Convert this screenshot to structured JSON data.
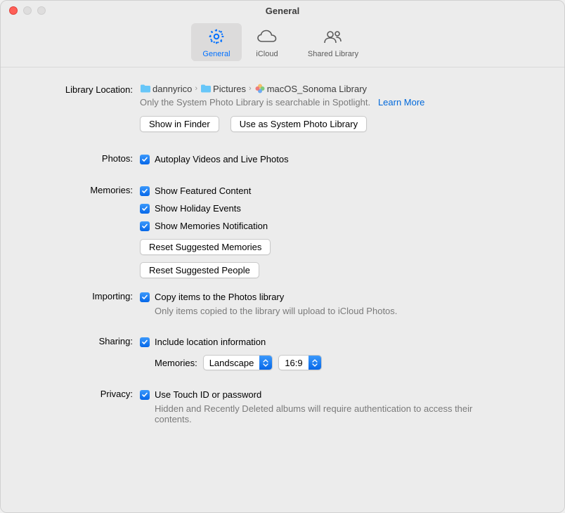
{
  "window": {
    "title": "General"
  },
  "toolbar": {
    "general": "General",
    "icloud": "iCloud",
    "shared_library": "Shared Library"
  },
  "library_location": {
    "label": "Library Location:",
    "path1": "dannyrico",
    "path2": "Pictures",
    "path3": "macOS_Sonoma Library",
    "caption": "Only the System Photo Library is searchable in Spotlight.",
    "learn_more": "Learn More",
    "show_in_finder": "Show in Finder",
    "use_as_system": "Use as System Photo Library"
  },
  "photos": {
    "label": "Photos:",
    "autoplay": "Autoplay Videos and Live Photos"
  },
  "memories": {
    "label": "Memories:",
    "show_featured": "Show Featured Content",
    "show_holiday": "Show Holiday Events",
    "show_notification": "Show Memories Notification",
    "reset_memories": "Reset Suggested Memories",
    "reset_people": "Reset Suggested People"
  },
  "importing": {
    "label": "Importing:",
    "copy_items": "Copy items to the Photos library",
    "caption": "Only items copied to the library will upload to iCloud Photos."
  },
  "sharing": {
    "label": "Sharing:",
    "include_location": "Include location information",
    "memories_label": "Memories:",
    "orientation": "Landscape",
    "aspect": "16:9"
  },
  "privacy": {
    "label": "Privacy:",
    "touch_id": "Use Touch ID or password",
    "caption": "Hidden and Recently Deleted albums will require authentication to access their contents."
  }
}
